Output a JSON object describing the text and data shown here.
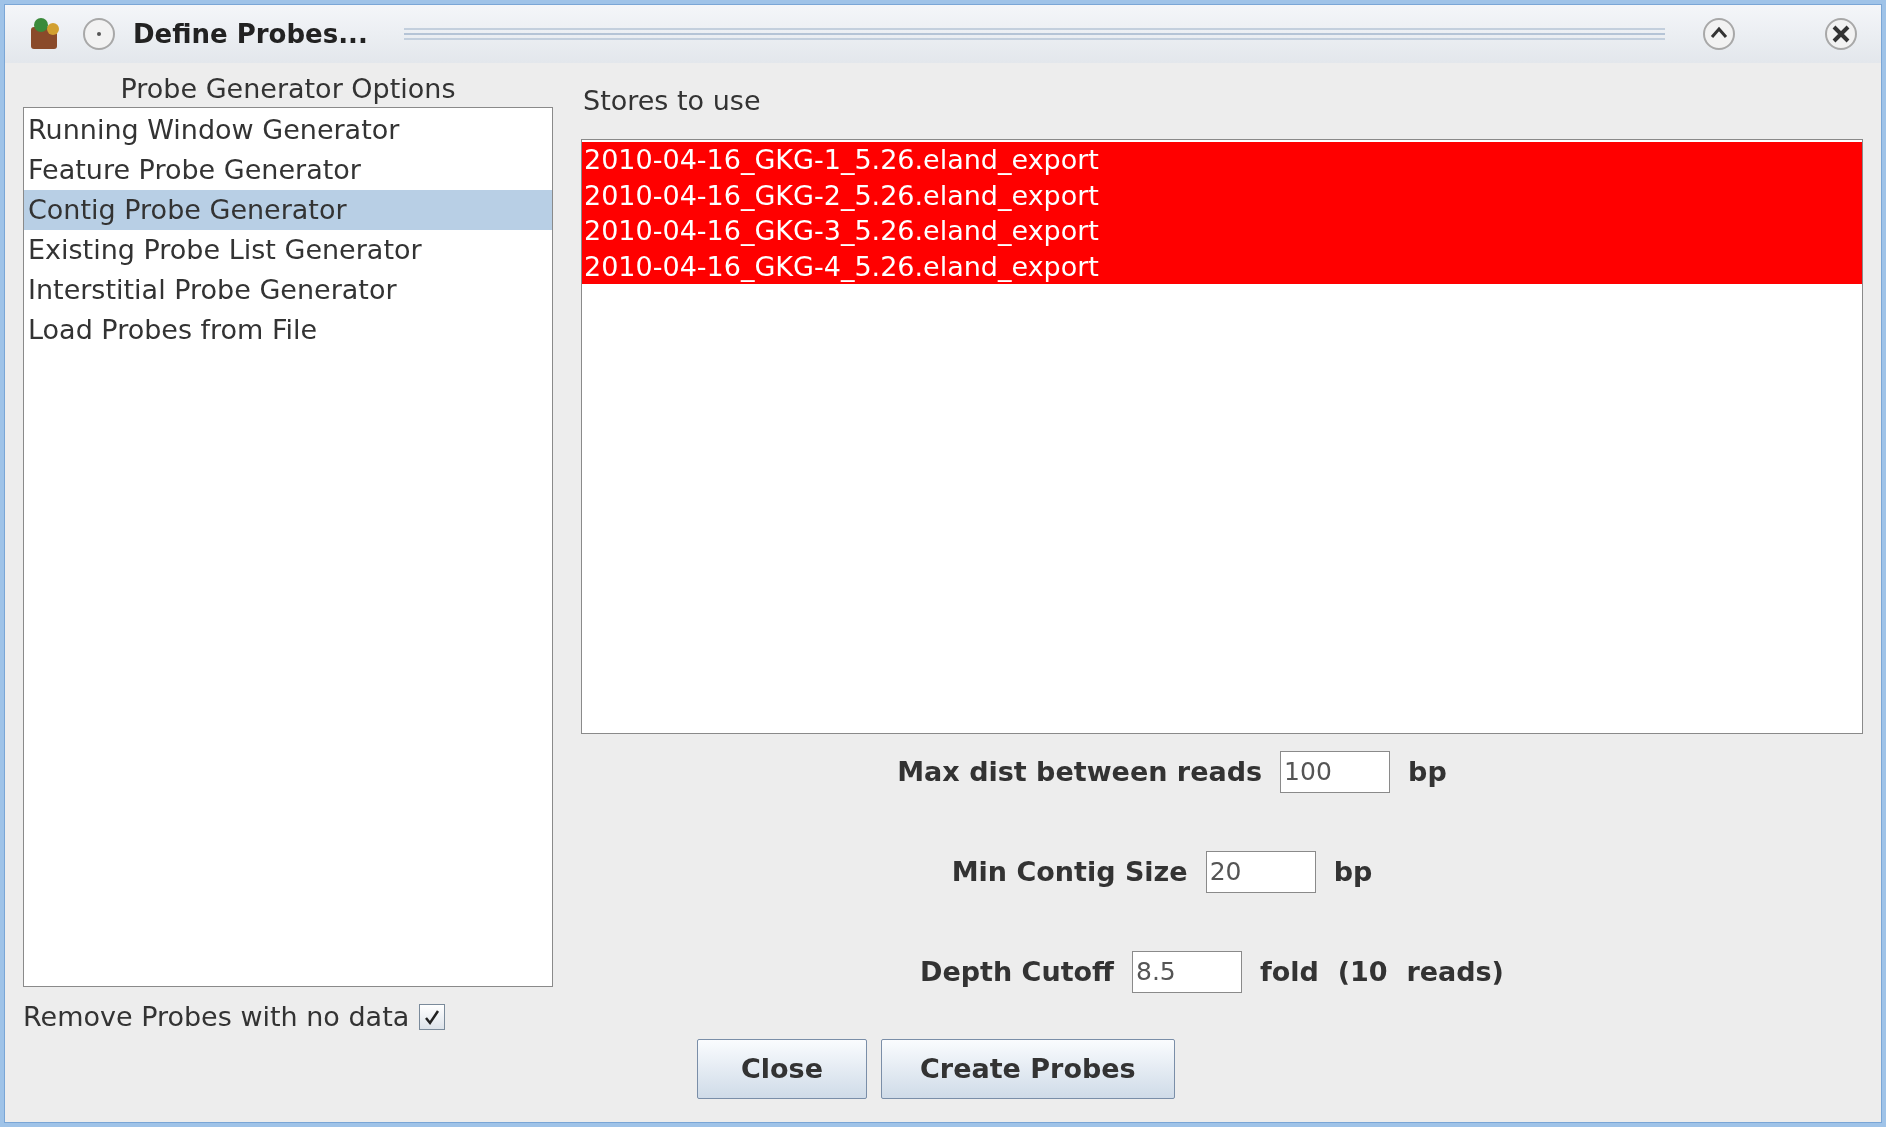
{
  "window": {
    "title": "Define Probes..."
  },
  "generator_options": {
    "title": "Probe Generator Options",
    "items": [
      {
        "label": "Running Window Generator",
        "selected": false
      },
      {
        "label": "Feature Probe Generator",
        "selected": false
      },
      {
        "label": "Contig Probe Generator",
        "selected": true
      },
      {
        "label": "Existing Probe List Generator",
        "selected": false
      },
      {
        "label": "Interstitial Probe Generator",
        "selected": false
      },
      {
        "label": "Load Probes from File",
        "selected": false
      }
    ]
  },
  "remove_probes": {
    "label": "Remove Probes with no data",
    "checked": true
  },
  "stores": {
    "title": "Stores to use",
    "items": [
      {
        "label": "2010-04-16_GKG-1_5.26.eland_export",
        "selected": true
      },
      {
        "label": "2010-04-16_GKG-2_5.26.eland_export",
        "selected": true
      },
      {
        "label": "2010-04-16_GKG-3_5.26.eland_export",
        "selected": true
      },
      {
        "label": "2010-04-16_GKG-4_5.26.eland_export",
        "selected": true
      }
    ]
  },
  "fields": [
    {
      "label": "Max dist between reads",
      "value": "100",
      "unit": "bp"
    },
    {
      "label": "Min Contig Size",
      "value": "20",
      "unit": "bp"
    },
    {
      "label": "Depth Cutoff",
      "value": "8.5",
      "unit": "fold  (10  reads)"
    }
  ],
  "buttons": [
    "Close",
    "Create Probes"
  ]
}
